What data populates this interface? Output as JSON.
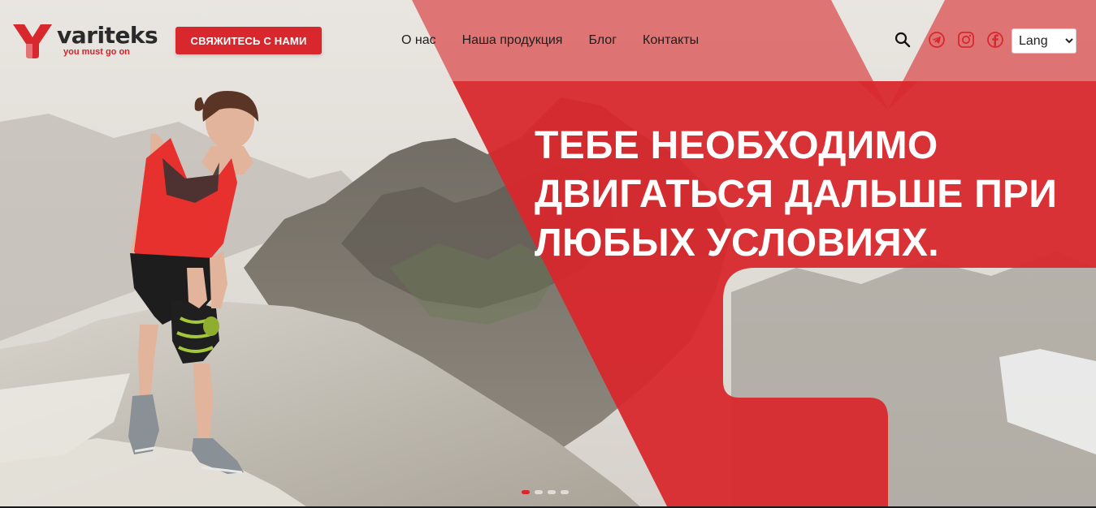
{
  "brand": {
    "name": "variteks",
    "slogan": "you must go on",
    "accent_color": "#d8282d"
  },
  "header": {
    "cta_label": "СВЯЖИТЕСЬ С НАМИ",
    "nav": [
      {
        "label": "О нас"
      },
      {
        "label": "Наша продукция"
      },
      {
        "label": "Блог"
      },
      {
        "label": "Контакты"
      }
    ],
    "icons": [
      "search-icon",
      "telegram-icon",
      "instagram-icon",
      "facebook-icon"
    ],
    "lang": {
      "selected": "Lang",
      "options": [
        "Lang"
      ]
    }
  },
  "hero": {
    "headline_lines": [
      "ТЕБЕ НЕОБХОДИМО",
      "ДВИГАТЬСЯ ДАЛЬШЕ ПРИ",
      "ЛЮБЫХ УСЛОВИЯХ."
    ],
    "slider": {
      "slides": 4,
      "active_index": 0
    }
  }
}
